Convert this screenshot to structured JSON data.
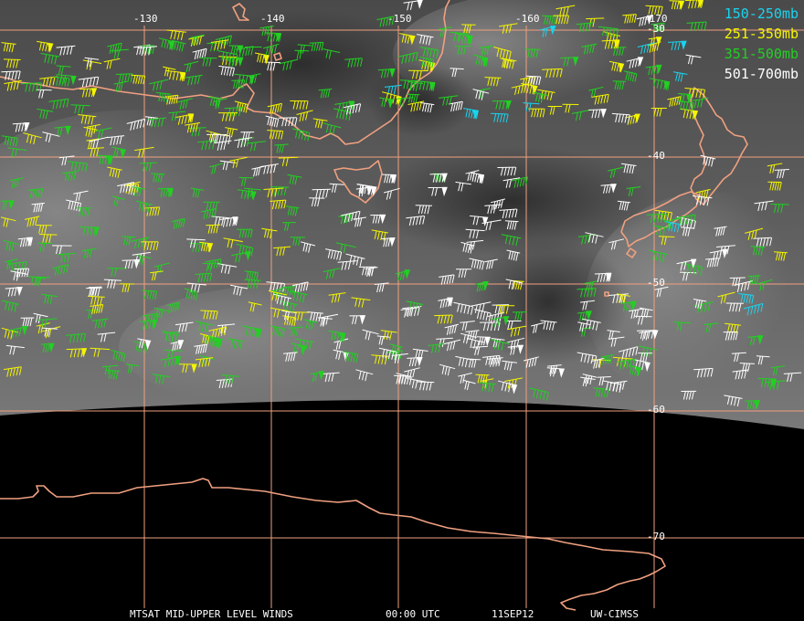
{
  "grid": {
    "longitudes": [
      "-130",
      "-140",
      "-150",
      "-160",
      "-170"
    ],
    "latitudes": [
      "-30",
      "-40",
      "-50",
      "-60",
      "-70"
    ],
    "color": "#f0a080"
  },
  "legend": [
    {
      "label": "150-250mb",
      "color": "#19d4ef"
    },
    {
      "label": "251-350mb",
      "color": "#f5f500"
    },
    {
      "label": "351-500mb",
      "color": "#22d022"
    },
    {
      "label": "501-700mb",
      "color": "#ffffff"
    }
  ],
  "footer": {
    "product": "MTSAT MID-UPPER LEVEL WINDS",
    "time": "00:00 UTC",
    "date": "11SEP12",
    "source": "UW-CIMSS"
  },
  "coastline_color": "#f0a080",
  "image_style": "water vapor satellite imagery with wind barbs"
}
